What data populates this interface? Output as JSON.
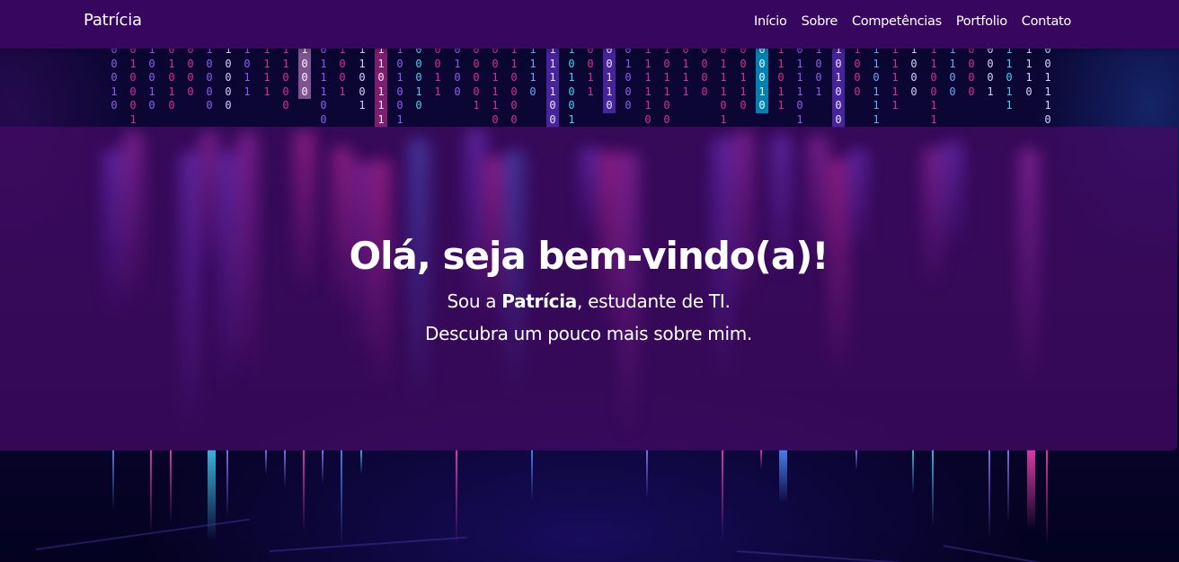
{
  "navbar": {
    "brand": "Patrícia",
    "links": [
      "Início",
      "Sobre",
      "Competências",
      "Portfolio",
      "Contato"
    ]
  },
  "hero": {
    "title": "Olá, seja bem-vindo(a)!",
    "line1_prefix": "Sou a ",
    "line1_name": "Patrícia",
    "line1_suffix": ", estudante de TI.",
    "line2": "Descubra um pouco mais sobre mim."
  },
  "colors": {
    "navbar_bg": "#370760",
    "hero_overlay": "#420a64",
    "binary_pink": "#d62f8f",
    "binary_cyan": "#3fd4f0",
    "background": "#05021a"
  },
  "background": {
    "kind": "binary-code-rain",
    "digits": "0 1"
  }
}
